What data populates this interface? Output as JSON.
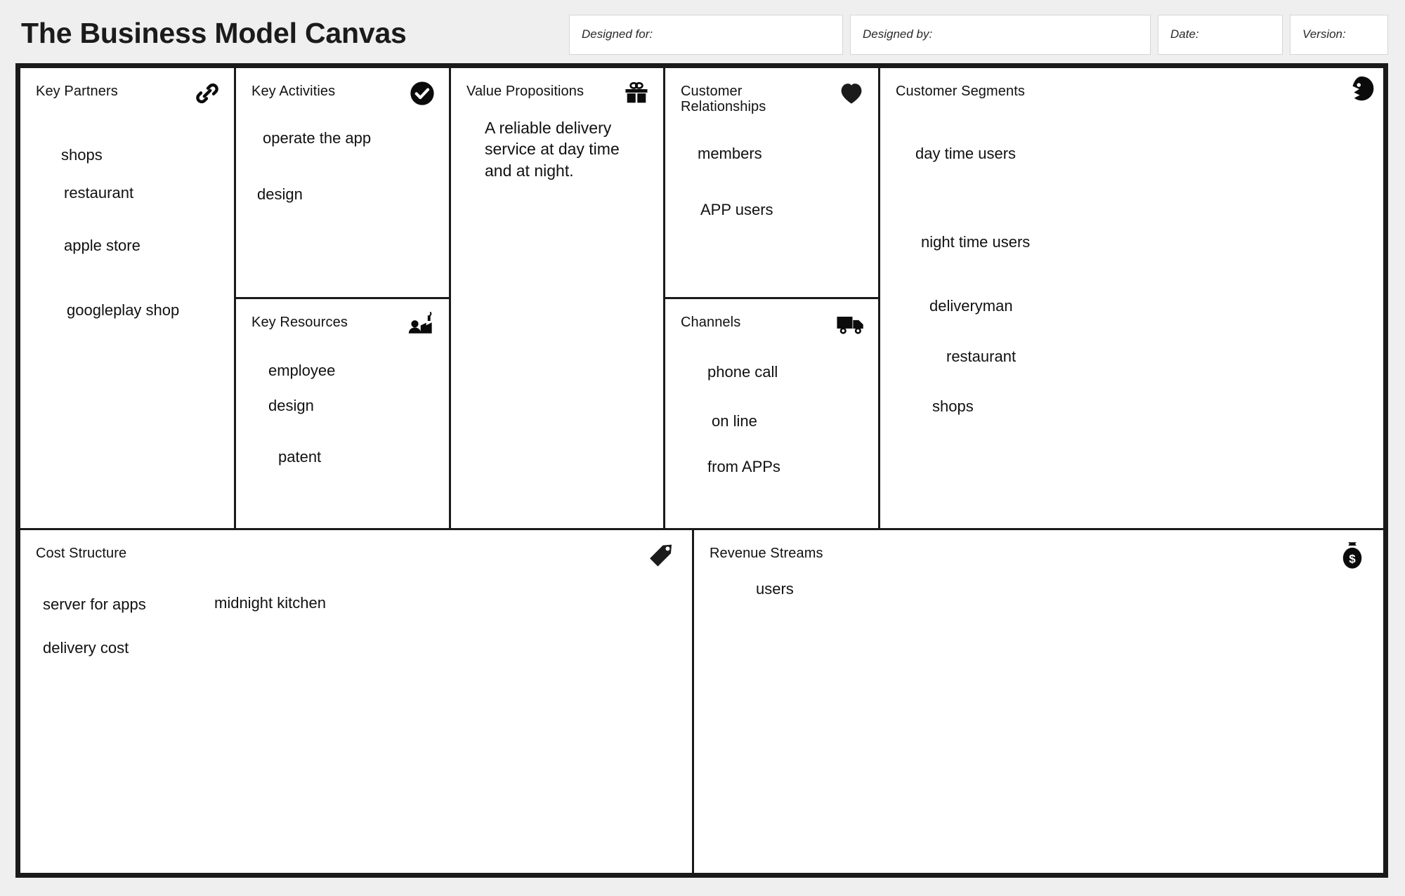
{
  "title": "The Business Model Canvas",
  "header_fields": [
    {
      "label": "Designed for:",
      "value": ""
    },
    {
      "label": "Designed by:",
      "value": ""
    },
    {
      "label": "Date:",
      "value": ""
    },
    {
      "label": "Version:",
      "value": ""
    }
  ],
  "blocks": {
    "key_partners": {
      "title": "Key Partners",
      "icon": "chain-link-icon",
      "notes": [
        "shops",
        "restaurant",
        "apple store",
        "googleplay shop"
      ]
    },
    "key_activities": {
      "title": "Key Activities",
      "icon": "check-circle-icon",
      "notes": [
        "operate the app",
        "design"
      ]
    },
    "key_resources": {
      "title": "Key Resources",
      "icon": "worker-factory-icon",
      "notes": [
        "employee",
        "design",
        "patent"
      ]
    },
    "value_propositions": {
      "title": "Value Propositions",
      "icon": "gift-icon",
      "text": "A reliable delivery service at day time and at night."
    },
    "customer_relationships": {
      "title": "Customer Relationships",
      "icon": "heart-icon",
      "notes": [
        "members",
        "APP users"
      ]
    },
    "channels": {
      "title": "Channels",
      "icon": "delivery-truck-icon",
      "notes": [
        "phone call",
        "on line",
        "from APPs"
      ]
    },
    "customer_segments": {
      "title": "Customer Segments",
      "icon": "customer-head-icon",
      "notes": [
        "day time users",
        "night time users",
        "deliveryman",
        "restaurant",
        "shops"
      ]
    },
    "cost_structure": {
      "title": "Cost Structure",
      "icon": "price-tag-icon",
      "notes": [
        "server for apps",
        "midnight kitchen",
        "delivery cost"
      ]
    },
    "revenue_streams": {
      "title": "Revenue Streams",
      "icon": "money-bag-icon",
      "notes": [
        "users"
      ]
    }
  },
  "colors": {
    "page_background": "#efefef",
    "frame": "#1a1a1a",
    "cell_background": "#ffffff",
    "text": "#111111"
  }
}
